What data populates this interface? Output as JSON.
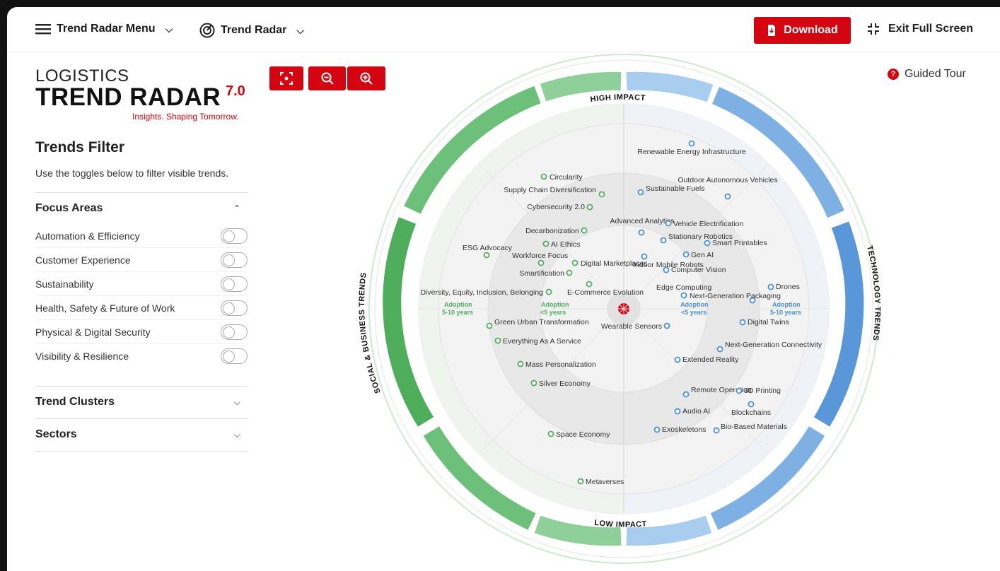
{
  "topbar": {
    "menu_label": "Trend Radar Menu",
    "radar_label": "Trend Radar",
    "download_label": "Download",
    "exit_label": "Exit Full Screen"
  },
  "logo": {
    "line1": "LOGISTICS",
    "line2": "TREND RADAR",
    "version": "7.0",
    "tagline": "Insights. Shaping Tomorrow."
  },
  "filter": {
    "title": "Trends Filter",
    "description": "Use the toggles below to filter visible trends.",
    "focus_areas_label": "Focus Areas",
    "focus_areas": [
      "Automation & Efficiency",
      "Customer Experience",
      "Sustainability",
      "Health, Safety & Future of Work",
      "Physical & Digital Security",
      "Visibility & Resilience"
    ],
    "trend_clusters_label": "Trend Clusters",
    "sectors_label": "Sectors"
  },
  "guided_tour_label": "Guided Tour",
  "radar": {
    "high_impact": "HIGH IMPACT",
    "low_impact": "LOW IMPACT",
    "left_label": "SOCIAL & BUSINESS TRENDS",
    "right_label": "TECHNOLOGY TRENDS",
    "adoption_left_outer": [
      "Adoption",
      "5-10 years"
    ],
    "adoption_left_inner": [
      "Adoption",
      "<5 years"
    ],
    "adoption_right_inner": [
      "Adoption",
      "<5 years"
    ],
    "adoption_right_outer": [
      "Adoption",
      "5-10 years"
    ],
    "colors": {
      "social": "#5cb85c",
      "tech": "#4a8fd8",
      "center": "#d40511"
    },
    "social_trends": [
      "Circularity",
      "Supply Chain Diversification",
      "Cybersecurity 2.0",
      "Decarbonization",
      "AI Ethics",
      "ESG Advocacy",
      "Workforce Focus",
      "Digital Marketplaces",
      "Smartification",
      "Diversity, Equity, Inclusion, Belonging",
      "E-Commerce Evolution",
      "Green Urban Transformation",
      "Everything As A Service",
      "Mass Personalization",
      "Silver Economy",
      "Space Economy",
      "Metaverses"
    ],
    "tech_trends": [
      "Renewable Energy Infrastructure",
      "Outdoor Autonomous Vehicles",
      "Sustainable Fuels",
      "Advanced Analytics",
      "Vehicle Electrification",
      "Stationary Robotics",
      "Smart Printables",
      "Gen AI",
      "Indoor Mobile Robots",
      "Computer Vision",
      "Edge Computing",
      "Drones",
      "Next-Generation Packaging",
      "Digital Twins",
      "Wearable Sensors",
      "Next-Generation Connectivity",
      "Extended Reality",
      "Remote Operation",
      "3D Printing",
      "Blockchains",
      "Audio AI",
      "Exoskeletons",
      "Bio-Based Materials"
    ]
  }
}
